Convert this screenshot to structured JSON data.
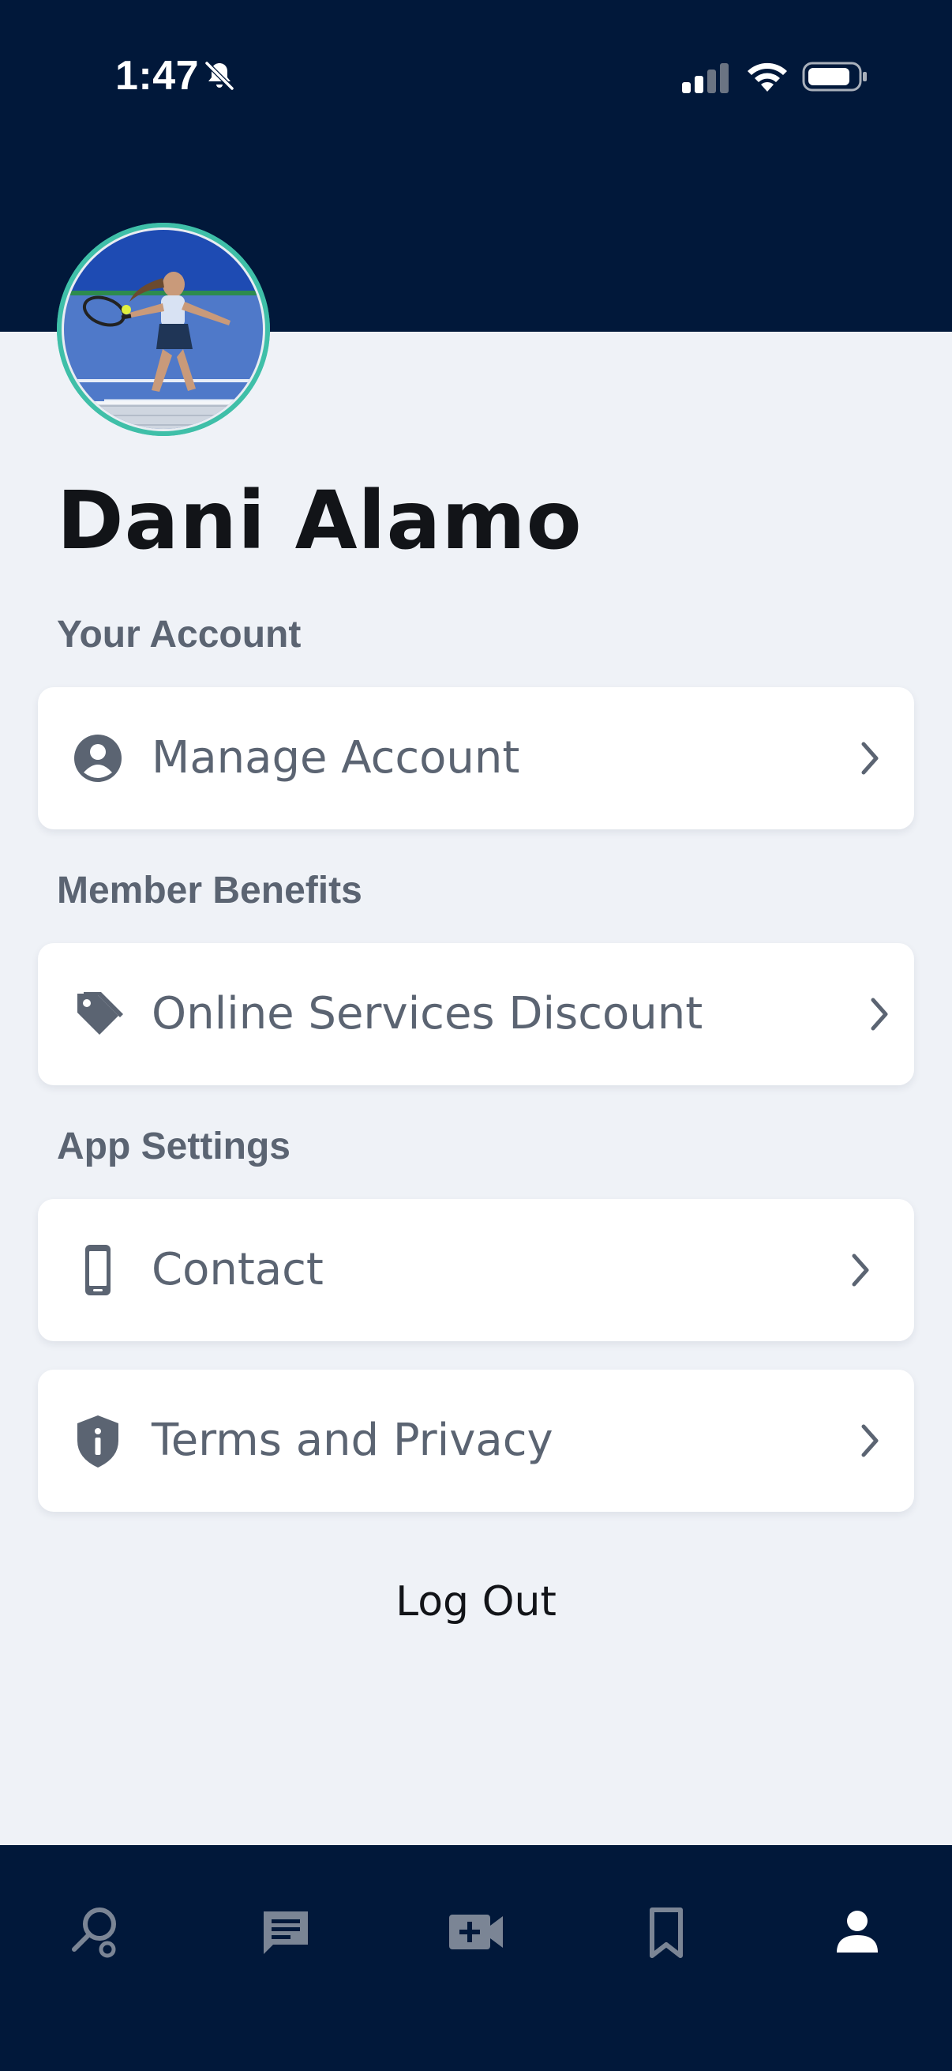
{
  "status_bar": {
    "time": "1:47",
    "icons": [
      "bell-slash-icon",
      "cellular-signal-icon",
      "wifi-icon",
      "battery-icon"
    ]
  },
  "profile": {
    "name": "Dani Alamo",
    "avatar": "avatar-photo"
  },
  "sections": {
    "your_account": {
      "title": "Your Account",
      "items": [
        {
          "label": "Manage Account",
          "icon": "user-circle-icon"
        }
      ]
    },
    "member_benefits": {
      "title": "Member Benefits",
      "items": [
        {
          "label": "Online Services Discount",
          "icon": "tag-icon"
        }
      ]
    },
    "app_settings": {
      "title": "App Settings",
      "items": [
        {
          "label": "Contact",
          "icon": "phone-icon"
        },
        {
          "label": "Terms and Privacy",
          "icon": "shield-info-icon"
        }
      ]
    }
  },
  "logout_label": "Log Out",
  "bottom_nav": {
    "items": [
      {
        "icon": "search-icon",
        "active": false
      },
      {
        "icon": "message-icon",
        "active": false
      },
      {
        "icon": "video-add-icon",
        "active": false
      },
      {
        "icon": "bookmark-icon",
        "active": false
      },
      {
        "icon": "profile-icon",
        "active": true
      }
    ]
  },
  "colors": {
    "header_bg": "#01183a",
    "page_bg": "#eff2f7",
    "card_bg": "#ffffff",
    "text_dark": "#121418",
    "text_muted": "#5b6472",
    "avatar_ring": "#3fbfa8",
    "nav_inactive": "#7b8595",
    "nav_active": "#ffffff"
  }
}
